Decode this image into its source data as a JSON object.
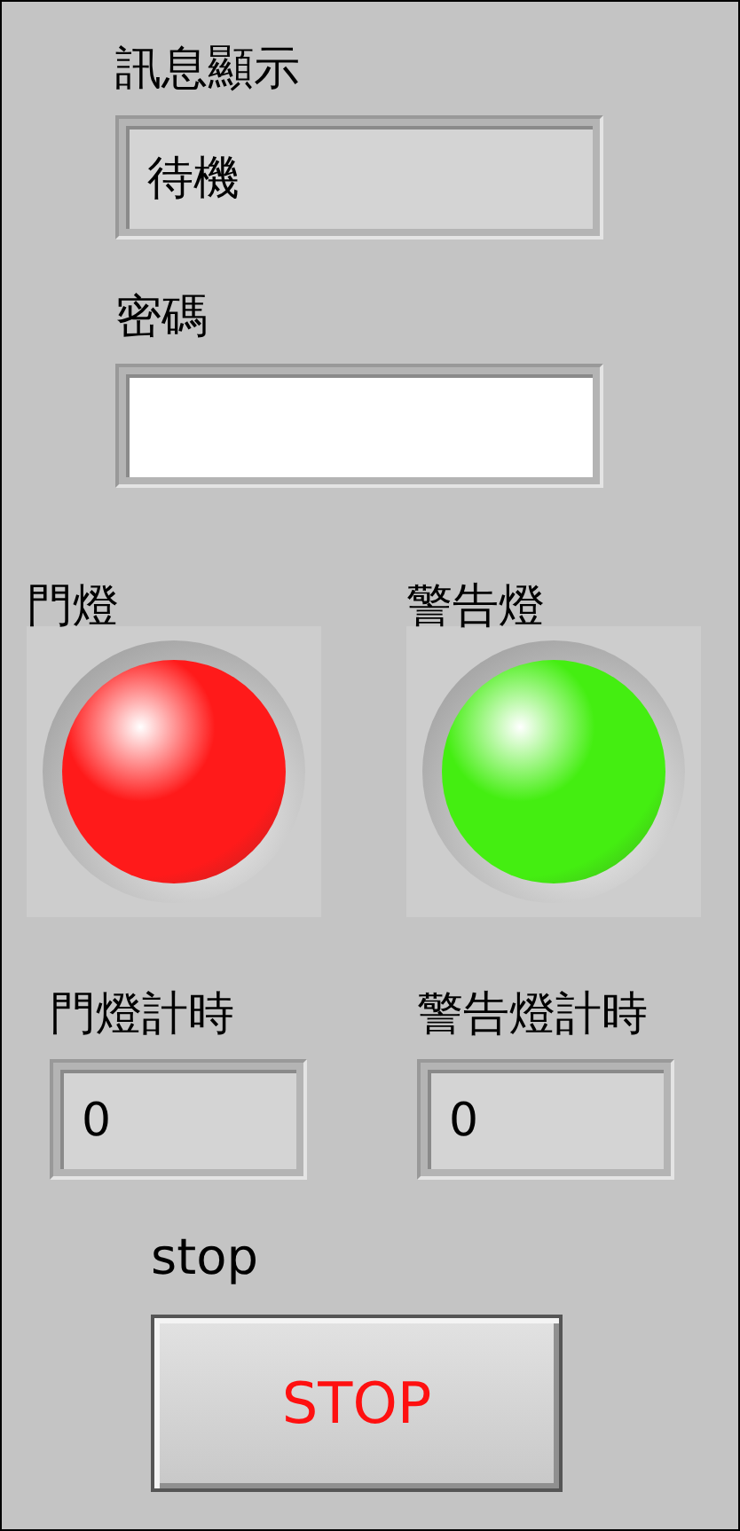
{
  "message": {
    "label": "訊息顯示",
    "value": "待機"
  },
  "password": {
    "label": "密碼"
  },
  "leds": [
    {
      "label": "門燈",
      "on": true,
      "color": "#ff1a1a"
    },
    {
      "label": "警告燈",
      "on": true,
      "color": "#44ee11"
    }
  ],
  "timers": [
    {
      "label": "門燈計時",
      "value": "0"
    },
    {
      "label": "警告燈計時",
      "value": "0"
    }
  ],
  "stop": {
    "label": "stop",
    "button": "STOP"
  }
}
